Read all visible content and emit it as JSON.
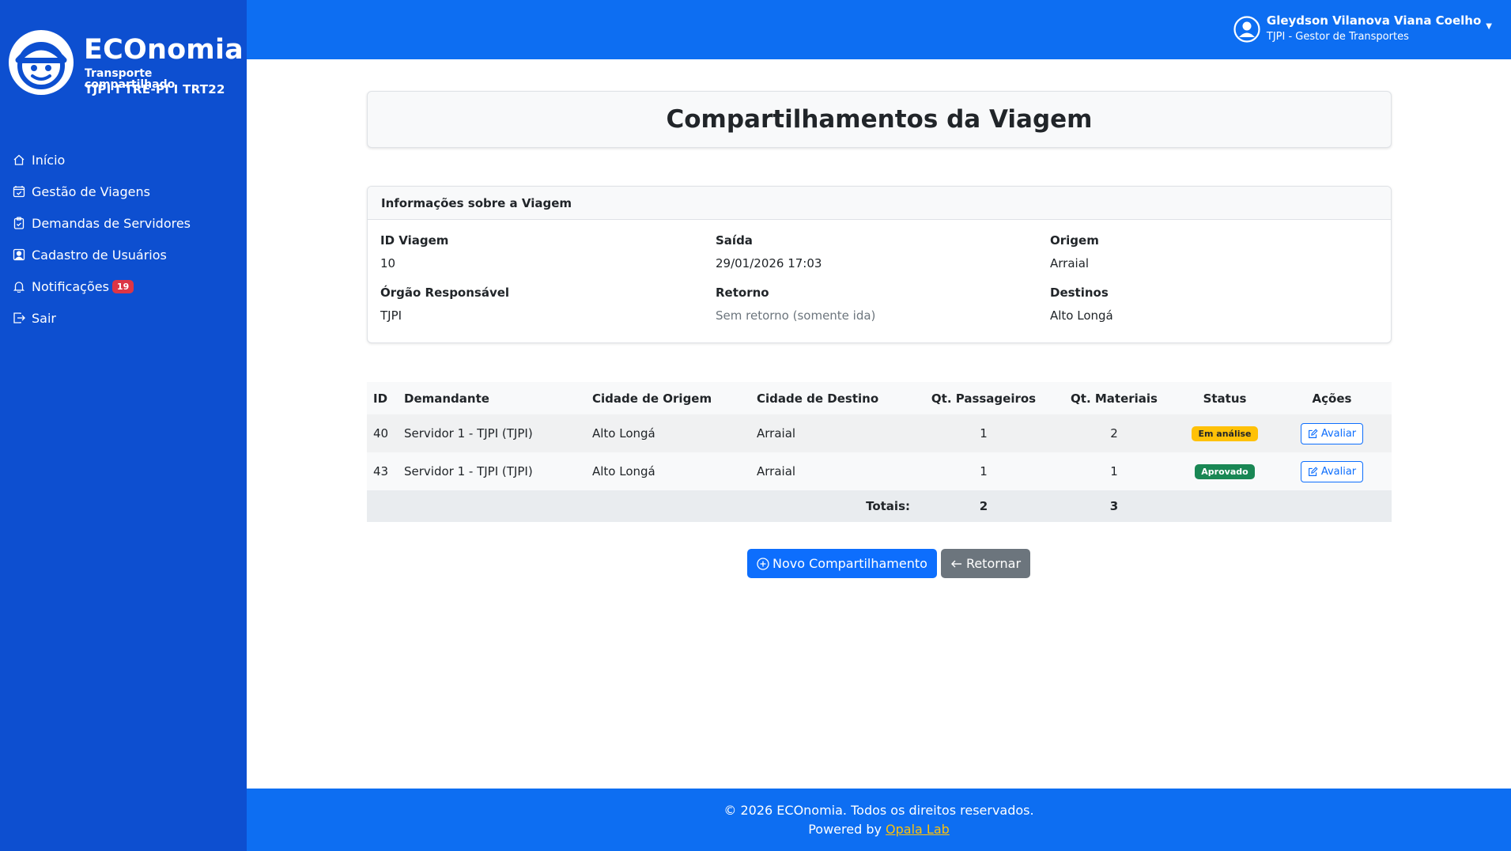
{
  "brand": {
    "name": "ECOnomia",
    "subtitle": "Transporte compartilhado",
    "orgs": "TJPI I TRE-PI I TRT22"
  },
  "sidebar": {
    "items": [
      {
        "label": "Início",
        "icon": "home-icon"
      },
      {
        "label": "Gestão de Viagens",
        "icon": "calendar-check-icon"
      },
      {
        "label": "Demandas de Servidores",
        "icon": "clipboard-icon"
      },
      {
        "label": "Cadastro de Usuários",
        "icon": "person-square-icon"
      },
      {
        "label": "Notificações",
        "icon": "bell-icon",
        "badge": "19"
      },
      {
        "label": "Sair",
        "icon": "logout-icon"
      }
    ]
  },
  "user": {
    "name": "Gleydson Vilanova Viana Coelho",
    "role": "TJPI - Gestor de Transportes"
  },
  "page": {
    "title": "Compartilhamentos da Viagem"
  },
  "info": {
    "header": "Informações sobre a Viagem",
    "fields": {
      "id_label": "ID Viagem",
      "id_value": "10",
      "saida_label": "Saída",
      "saida_value": "29/01/2026 17:03",
      "origem_label": "Origem",
      "origem_value": "Arraial",
      "orgao_label": "Órgão Responsável",
      "orgao_value": "TJPI",
      "retorno_label": "Retorno",
      "retorno_value": "Sem retorno (somente ida)",
      "destinos_label": "Destinos",
      "destinos_value": "Alto Longá"
    }
  },
  "table": {
    "headers": [
      "ID",
      "Demandante",
      "Cidade de Origem",
      "Cidade de Destino",
      "Qt. Passageiros",
      "Qt. Materiais",
      "Status",
      "Ações"
    ],
    "rows": [
      {
        "id": "40",
        "demandante": "Servidor 1 - TJPI (TJPI)",
        "origem": "Alto Longá",
        "destino": "Arraial",
        "passageiros": "1",
        "materiais": "2",
        "status": "Em análise",
        "acao": "Avaliar"
      },
      {
        "id": "43",
        "demandante": "Servidor 1 - TJPI (TJPI)",
        "origem": "Alto Longá",
        "destino": "Arraial",
        "passageiros": "1",
        "materiais": "1",
        "status": "Aprovado",
        "acao": "Avaliar"
      }
    ],
    "totals": {
      "label": "Totais:",
      "passageiros": "2",
      "materiais": "3"
    }
  },
  "buttons": {
    "novo": "Novo Compartilhamento",
    "retornar": "Retornar"
  },
  "footer": {
    "copyright": "© 2026 ECOnomia. Todos os direitos reservados.",
    "powered_prefix": "Powered by ",
    "powered_link": "Opala Lab"
  },
  "colors": {
    "sidebar": "#0d4fd0",
    "topbar": "#0d6ef2",
    "primary": "#0d6efd",
    "warning": "#ffc107",
    "success": "#198754",
    "danger": "#dc3545"
  }
}
